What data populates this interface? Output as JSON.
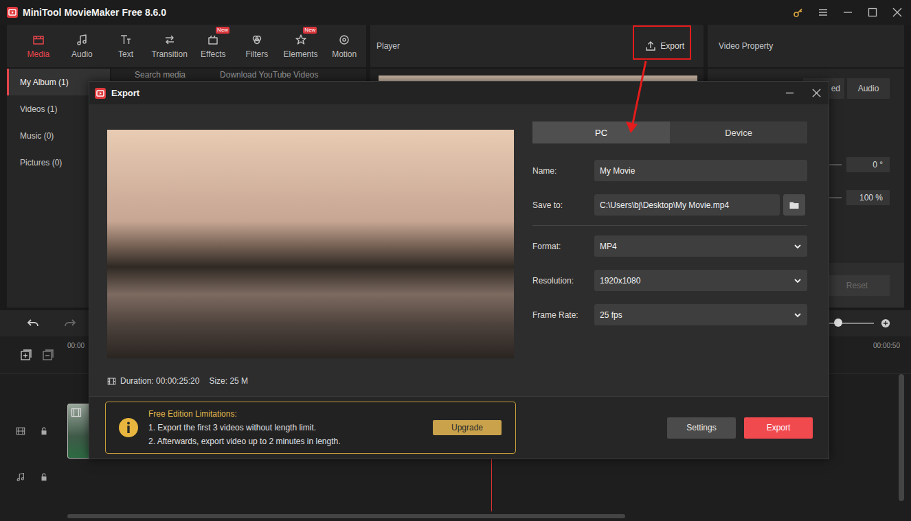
{
  "window": {
    "title": "MiniTool MovieMaker Free 8.6.0"
  },
  "toolbar": [
    {
      "label": "Media",
      "selected": true,
      "badge": ""
    },
    {
      "label": "Audio",
      "selected": false,
      "badge": ""
    },
    {
      "label": "Text",
      "selected": false,
      "badge": ""
    },
    {
      "label": "Transition",
      "selected": false,
      "badge": ""
    },
    {
      "label": "Effects",
      "selected": false,
      "badge": "New"
    },
    {
      "label": "Filters",
      "selected": false,
      "badge": ""
    },
    {
      "label": "Elements",
      "selected": false,
      "badge": "New"
    },
    {
      "label": "Motion",
      "selected": false,
      "badge": ""
    }
  ],
  "sidebar": [
    {
      "label": "My Album (1)",
      "selected": true
    },
    {
      "label": "Videos (1)",
      "selected": false
    },
    {
      "label": "Music (0)",
      "selected": false
    },
    {
      "label": "Pictures (0)",
      "selected": false
    }
  ],
  "media_bar": {
    "search": "Search media",
    "download": "Download YouTube Videos"
  },
  "player": {
    "title": "Player",
    "export": "Export"
  },
  "property": {
    "title": "Video Property",
    "tabs": [
      {
        "label": "ed",
        "selected": false
      },
      {
        "label": "Audio",
        "selected": false
      }
    ],
    "rotation": "0 °",
    "scale": "100 %",
    "reset": "Reset",
    "reset_disabled": true
  },
  "timeline": {
    "ruler": [
      "00:00",
      "00:00:50"
    ],
    "zoom": {
      "level": 0.57
    },
    "redo_disabled": true
  },
  "dialog": {
    "title": "Export",
    "tabs": [
      {
        "label": "PC",
        "selected": true
      },
      {
        "label": "Device",
        "selected": false
      }
    ],
    "fields": [
      {
        "label": "Name:",
        "value": "My Movie",
        "kind": "text"
      },
      {
        "label": "Save to:",
        "value": "C:\\Users\\bj\\Desktop\\My Movie.mp4",
        "kind": "path"
      },
      {
        "label": "Format:",
        "value": "MP4",
        "kind": "select"
      },
      {
        "label": "Resolution:",
        "value": "1920x1080",
        "kind": "select"
      },
      {
        "label": "Frame Rate:",
        "value": "25 fps",
        "kind": "select"
      }
    ],
    "duration_label": "Duration:",
    "duration": "00:00:25:20",
    "size_label": "Size:",
    "size": "25 M",
    "limits": {
      "title": "Free Edition Limitations:",
      "lines": [
        "1. Export the first 3 videos without length limit.",
        "2. Afterwards, export video up to 2 minutes in length."
      ],
      "upgrade": "Upgrade"
    },
    "buttons": [
      {
        "label": "Settings",
        "kind": "secondary"
      },
      {
        "label": "Export",
        "kind": "primary"
      }
    ]
  }
}
